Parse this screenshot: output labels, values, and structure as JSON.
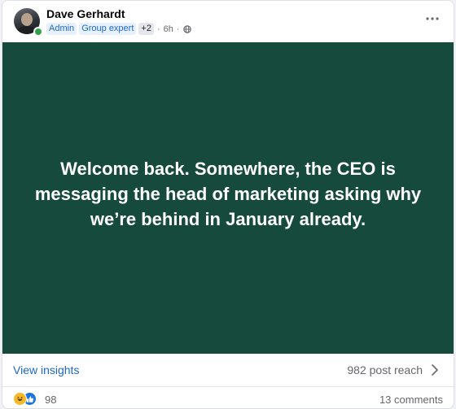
{
  "post": {
    "author": {
      "name": "Dave Gerhardt",
      "online": true
    },
    "badges": [
      "Admin",
      "Group expert"
    ],
    "badges_more": "+2",
    "separator": "·",
    "time": "6h",
    "visibility_icon": "globe-icon",
    "more_icon": "more-horizontal-icon",
    "background_color": "#164a3d",
    "text": "Welcome back. Somewhere, the CEO is messaging the head of marketing asking why we’re behind in January already."
  },
  "insights": {
    "label": "View insights",
    "reach": "982 post reach",
    "chevron_icon": "chevron-right-icon"
  },
  "reactions": {
    "icons": [
      "haha-reaction-icon",
      "like-reaction-icon"
    ],
    "count": "98",
    "comments": "13 comments"
  }
}
